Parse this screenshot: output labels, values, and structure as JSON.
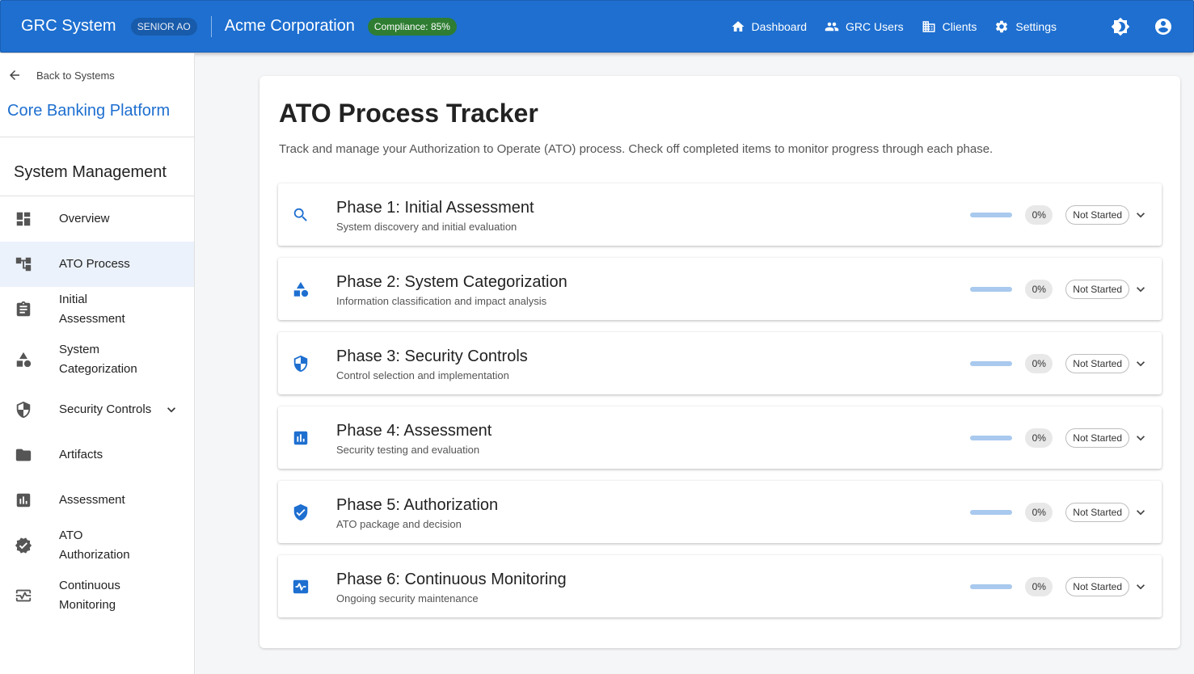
{
  "header": {
    "brand": "GRC System",
    "role": "SENIOR AO",
    "organization": "Acme Corporation",
    "compliance": "Compliance: 85%",
    "nav": [
      {
        "label": "Dashboard",
        "icon": "home-icon"
      },
      {
        "label": "GRC Users",
        "icon": "users-icon"
      },
      {
        "label": "Clients",
        "icon": "building-icon"
      },
      {
        "label": "Settings",
        "icon": "gear-icon"
      }
    ],
    "theme_icon": "brightness-icon",
    "account_icon": "account-circle-icon"
  },
  "sidebar": {
    "back_label": "Back to Systems",
    "system_name": "Core Banking Platform",
    "section_title": "System Management",
    "items": [
      {
        "label": "Overview",
        "icon": "dashboard-icon"
      },
      {
        "label": "ATO Process",
        "icon": "account-tree-icon",
        "active": true
      },
      {
        "label": "Initial Assessment",
        "icon": "assignment-icon"
      },
      {
        "label": "System Categorization",
        "icon": "category-icon"
      },
      {
        "label": "Security Controls",
        "icon": "shield-icon",
        "expandable": true
      },
      {
        "label": "Artifacts",
        "icon": "folder-icon"
      },
      {
        "label": "Assessment",
        "icon": "bar-chart-icon"
      },
      {
        "label": "ATO Authorization",
        "icon": "verified-icon"
      },
      {
        "label": "Continuous Monitoring",
        "icon": "monitor-heart-icon"
      }
    ]
  },
  "main": {
    "title": "ATO Process Tracker",
    "description": "Track and manage your Authorization to Operate (ATO) process. Check off completed items to monitor progress through each phase.",
    "phases": [
      {
        "title": "Phase 1: Initial Assessment",
        "subtitle": "System discovery and initial evaluation",
        "progress": 0,
        "progress_label": "0%",
        "status": "Not Started",
        "icon": "search-icon"
      },
      {
        "title": "Phase 2: System Categorization",
        "subtitle": "Information classification and impact analysis",
        "progress": 0,
        "progress_label": "0%",
        "status": "Not Started",
        "icon": "category-icon"
      },
      {
        "title": "Phase 3: Security Controls",
        "subtitle": "Control selection and implementation",
        "progress": 0,
        "progress_label": "0%",
        "status": "Not Started",
        "icon": "shield-icon"
      },
      {
        "title": "Phase 4: Assessment",
        "subtitle": "Security testing and evaluation",
        "progress": 0,
        "progress_label": "0%",
        "status": "Not Started",
        "icon": "bar-chart-icon"
      },
      {
        "title": "Phase 5: Authorization",
        "subtitle": "ATO package and decision",
        "progress": 0,
        "progress_label": "0%",
        "status": "Not Started",
        "icon": "verified-user-icon"
      },
      {
        "title": "Phase 6: Continuous Monitoring",
        "subtitle": "Ongoing security maintenance",
        "progress": 0,
        "progress_label": "0%",
        "status": "Not Started",
        "icon": "monitor-heart-icon"
      }
    ]
  },
  "colors": {
    "primary": "#1e6fd0",
    "compliance_chip": "#2e7d32",
    "active_item_bg": "#ebf2fb",
    "progress_track": "#a9c9ee"
  }
}
